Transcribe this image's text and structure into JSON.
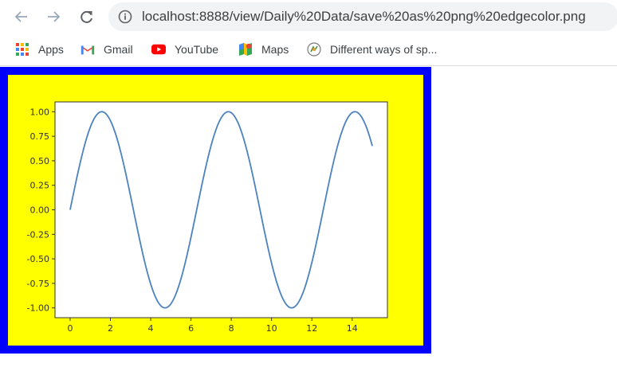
{
  "browser": {
    "url": "localhost:8888/view/Daily%20Data/save%20as%20png%20edgecolor.png",
    "bookmarks": [
      {
        "label": "Apps",
        "icon": "apps-grid-icon"
      },
      {
        "label": "Gmail",
        "icon": "gmail-icon"
      },
      {
        "label": "YouTube",
        "icon": "youtube-icon"
      },
      {
        "label": "Maps",
        "icon": "maps-icon"
      },
      {
        "label": "Different ways of sp...",
        "icon": "site-favicon-icon"
      }
    ]
  },
  "colors": {
    "frame_edge": "#0000ff",
    "figure_face": "#ffff00",
    "line": "#4c82c0"
  },
  "chart_data": {
    "type": "line",
    "function": "sin(x)",
    "xlim": [
      -0.75,
      15.75
    ],
    "ylim": [
      -1.1,
      1.1
    ],
    "xticks": [
      "0",
      "2",
      "4",
      "6",
      "8",
      "10",
      "12",
      "14"
    ],
    "yticks": [
      "1.00",
      "0.75",
      "0.50",
      "0.25",
      "0.00",
      "-0.25",
      "-0.50",
      "-0.75",
      "-1.00"
    ],
    "xrange": [
      0,
      15
    ],
    "series": [
      {
        "values_note": "y = sin(x) for x from 0 to 15"
      }
    ]
  }
}
